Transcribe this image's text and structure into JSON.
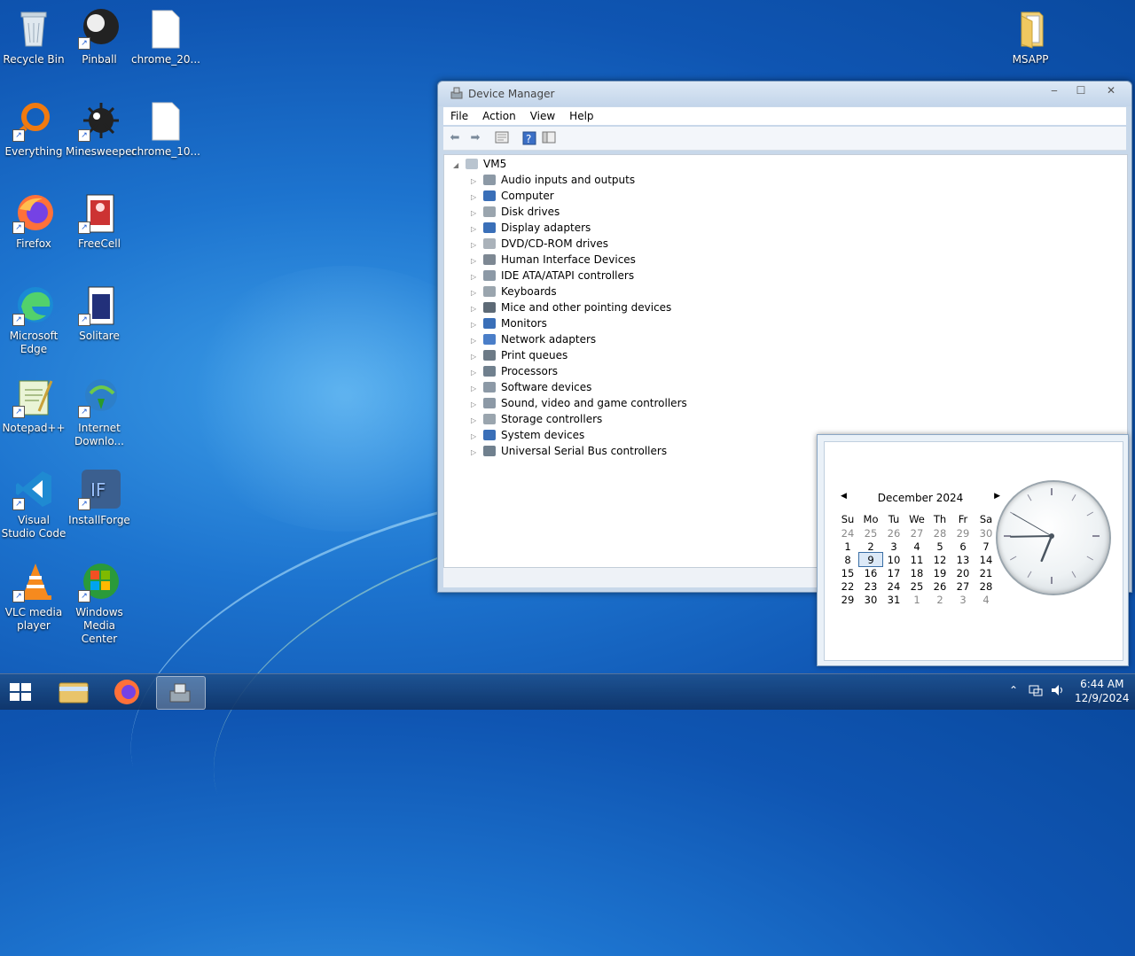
{
  "desktop": {
    "icons": [
      {
        "label": "Recycle Bin",
        "icon": "recycle-bin-icon"
      },
      {
        "label": "Pinball",
        "icon": "pinball-icon"
      },
      {
        "label": "chrome_20...",
        "icon": "file-icon"
      },
      {
        "label": "Everything",
        "icon": "everything-icon"
      },
      {
        "label": "Minesweeper",
        "icon": "minesweeper-icon"
      },
      {
        "label": "chrome_10...",
        "icon": "file-icon"
      },
      {
        "label": "Firefox",
        "icon": "firefox-icon"
      },
      {
        "label": "FreeCell",
        "icon": "freecell-icon"
      },
      {
        "label": "Microsoft Edge",
        "icon": "edge-icon"
      },
      {
        "label": "Solitare",
        "icon": "solitaire-icon"
      },
      {
        "label": "Notepad++",
        "icon": "notepadpp-icon"
      },
      {
        "label": "Internet Downlo...",
        "icon": "idm-icon"
      },
      {
        "label": "Visual Studio Code",
        "icon": "vscode-icon"
      },
      {
        "label": "InstallForge",
        "icon": "installforge-icon"
      },
      {
        "label": "VLC media player",
        "icon": "vlc-icon"
      },
      {
        "label": "Windows Media Center",
        "icon": "media-center-icon"
      },
      {
        "label": "MSAPP",
        "icon": "folder-icon"
      }
    ]
  },
  "window": {
    "title": "Device Manager",
    "controls": {
      "minimize": "‒",
      "maximize": "☐",
      "close": "✕"
    },
    "menu": [
      "File",
      "Action",
      "View",
      "Help"
    ],
    "root": "VM5",
    "categories": [
      "Audio inputs and outputs",
      "Computer",
      "Disk drives",
      "Display adapters",
      "DVD/CD-ROM drives",
      "Human Interface Devices",
      "IDE ATA/ATAPI controllers",
      "Keyboards",
      "Mice and other pointing devices",
      "Monitors",
      "Network adapters",
      "Print queues",
      "Processors",
      "Software devices",
      "Sound, video and game controllers",
      "Storage controllers",
      "System devices",
      "Universal Serial Bus controllers"
    ]
  },
  "calendar": {
    "month": "December 2024",
    "prev": "◀",
    "next": "▶",
    "weekdays": [
      "Su",
      "Mo",
      "Tu",
      "We",
      "Th",
      "Fr",
      "Sa"
    ],
    "weeks": [
      [
        "24",
        "25",
        "26",
        "27",
        "28",
        "29",
        "30"
      ],
      [
        "1",
        "2",
        "3",
        "4",
        "5",
        "6",
        "7"
      ],
      [
        "8",
        "9",
        "10",
        "11",
        "12",
        "13",
        "14"
      ],
      [
        "15",
        "16",
        "17",
        "18",
        "19",
        "20",
        "21"
      ],
      [
        "22",
        "23",
        "24",
        "25",
        "26",
        "27",
        "28"
      ],
      [
        "29",
        "30",
        "31",
        "1",
        "2",
        "3",
        "4"
      ]
    ],
    "today": "9",
    "clock_time": {
      "hour": 6,
      "minute": 44,
      "second": 50
    }
  },
  "taskbar": {
    "time": "6:44 AM",
    "date": "12/9/2024",
    "tray_icons": [
      "chevron-up-icon",
      "network-icon",
      "volume-icon",
      "clock-icon"
    ]
  },
  "colors": {
    "accent": "#1d74cf",
    "window_frame": "#c8d8ea"
  }
}
